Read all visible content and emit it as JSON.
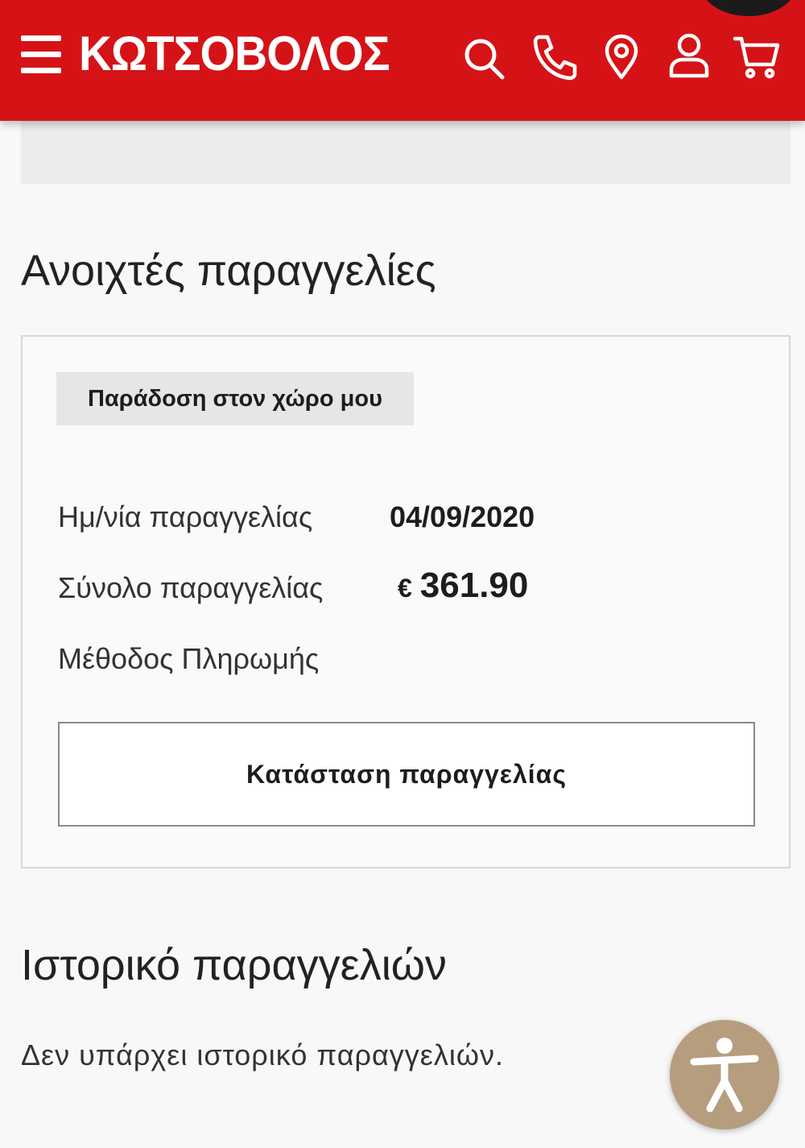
{
  "header": {
    "brand": "ΚΩΤΣΟΒΟΛΟΣ",
    "brand_color": "#d51317",
    "icons": [
      "menu-icon",
      "search-icon",
      "phone-icon",
      "location-pin-icon",
      "user-icon",
      "cart-icon"
    ]
  },
  "open_orders": {
    "title": "Ανοιχτές παραγγελίες",
    "order": {
      "delivery_type": "Παράδοση στον χώρο μου",
      "date_label": "Ημ/νία παραγγελίας",
      "date_value": "04/09/2020",
      "total_label": "Σύνολο παραγγελίας",
      "currency": "€",
      "total_value": "361.90",
      "payment_label": "Μέθοδος Πληρωμής",
      "status_button": "Κατάσταση παραγγελίας"
    }
  },
  "history": {
    "title": "Ιστορικό παραγγελιών",
    "empty_text": "Δεν υπάρχει ιστορικό παραγγελιών."
  },
  "accessibility": {
    "icon": "accessibility-icon",
    "color": "#b59d7e"
  }
}
